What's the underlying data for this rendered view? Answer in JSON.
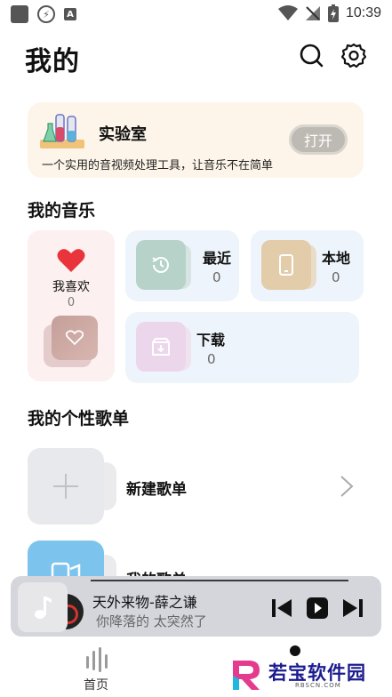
{
  "status_bar": {
    "time": "10:39",
    "a_badge": "A"
  },
  "header": {
    "title": "我的"
  },
  "lab": {
    "title": "实验室",
    "description": "一个实用的音视频处理工具，让音乐不在简单",
    "open_label": "打开"
  },
  "my_music": {
    "section_title": "我的音乐",
    "favorites": {
      "label": "我喜欢",
      "count": "0"
    },
    "recent": {
      "label": "最近",
      "count": "0"
    },
    "local": {
      "label": "本地",
      "count": "0"
    },
    "download": {
      "label": "下载",
      "count": "0"
    }
  },
  "playlists": {
    "section_title": "我的个性歌单",
    "new_label": "新建歌单",
    "mine_label": "我的歌单"
  },
  "player": {
    "song": "天外来物-薛之谦",
    "lyric": "你降落的 太突然了"
  },
  "nav": {
    "home_label": "首页"
  },
  "watermark": {
    "name": "若宝软件园",
    "site": "RBSCN.COM"
  },
  "colors": {
    "lab_bg": "#fdf5e9",
    "fav_bg": "#fdf0f0",
    "tile_bg": "#eef4fb",
    "heart": "#e8343a",
    "player_bg": "#d4d6dc",
    "watermark_text": "#1b1b8f"
  }
}
